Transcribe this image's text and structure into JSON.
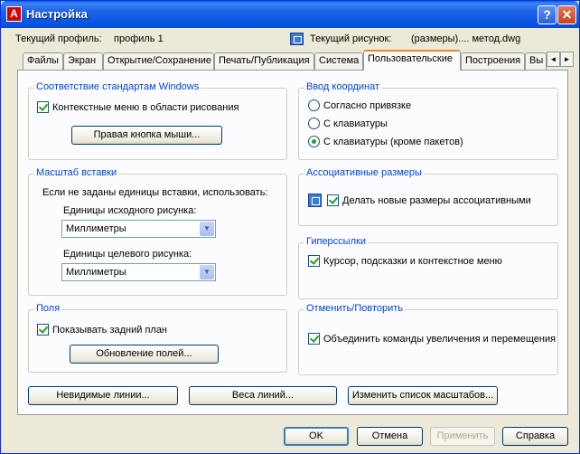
{
  "window": {
    "title": "Настройка",
    "app_icon": "autocad-icon",
    "help_symbol": "?",
    "close_symbol": "✕"
  },
  "profile": {
    "current_profile_label": "Текущий профиль:",
    "current_profile_value": "профиль 1",
    "current_drawing_label": "Текущий рисунок:",
    "current_drawing_value": "(размеры).... метод.dwg"
  },
  "tabs": [
    {
      "label": "Файлы",
      "active": false
    },
    {
      "label": "Экран",
      "active": false
    },
    {
      "label": "Открытие/Сохранение",
      "active": false
    },
    {
      "label": "Печать/Публикация",
      "active": false
    },
    {
      "label": "Система",
      "active": false
    },
    {
      "label": "Пользовательские",
      "active": true
    },
    {
      "label": "Построения",
      "active": false
    },
    {
      "label": "Вы",
      "active": false
    }
  ],
  "tab_scroll": {
    "left": "◄",
    "right": "►"
  },
  "windows_standard": {
    "title": "Соответствие стандартам Windows",
    "context_menu_label": "Контекстные меню в области рисования",
    "context_menu_checked": true,
    "right_click_button": "Правая кнопка мыши..."
  },
  "insert_scale": {
    "title": "Масштаб вставки",
    "description": "Если не заданы единицы вставки, использовать:",
    "source_label": "Единицы исходного рисунка:",
    "source_value": "Миллиметры",
    "target_label": "Единицы целевого рисунка:",
    "target_value": "Миллиметры"
  },
  "fields": {
    "title": "Поля",
    "show_background_label": "Показывать задний план",
    "show_background_checked": true,
    "update_fields_button": "Обновление полей..."
  },
  "coordinate_input": {
    "title": "Ввод координат",
    "options": [
      {
        "label": "Согласно привязке",
        "checked": false
      },
      {
        "label": "С клавиатуры",
        "checked": false
      },
      {
        "label": "С клавиатуры (кроме пакетов)",
        "checked": true
      }
    ]
  },
  "associative_dims": {
    "title": "Ассоциативные размеры",
    "make_associative_label": "Делать новые размеры ассоциативными",
    "make_associative_checked": true
  },
  "hyperlinks": {
    "title": "Гиперссылки",
    "cursor_label": "Курсор, подсказки и контекстное меню",
    "cursor_checked": true
  },
  "undo_redo": {
    "title": "Отменить/Повторить",
    "combine_label": "Объединить команды увеличения и перемещения",
    "combine_checked": true
  },
  "bottom_buttons": {
    "hidden_lines": "Невидимые линии...",
    "lineweights": "Веса линий...",
    "edit_scale_list": "Изменить список масштабов..."
  },
  "dialog_buttons": {
    "ok": "OK",
    "cancel": "Отмена",
    "apply": "Применить",
    "help": "Справка"
  }
}
